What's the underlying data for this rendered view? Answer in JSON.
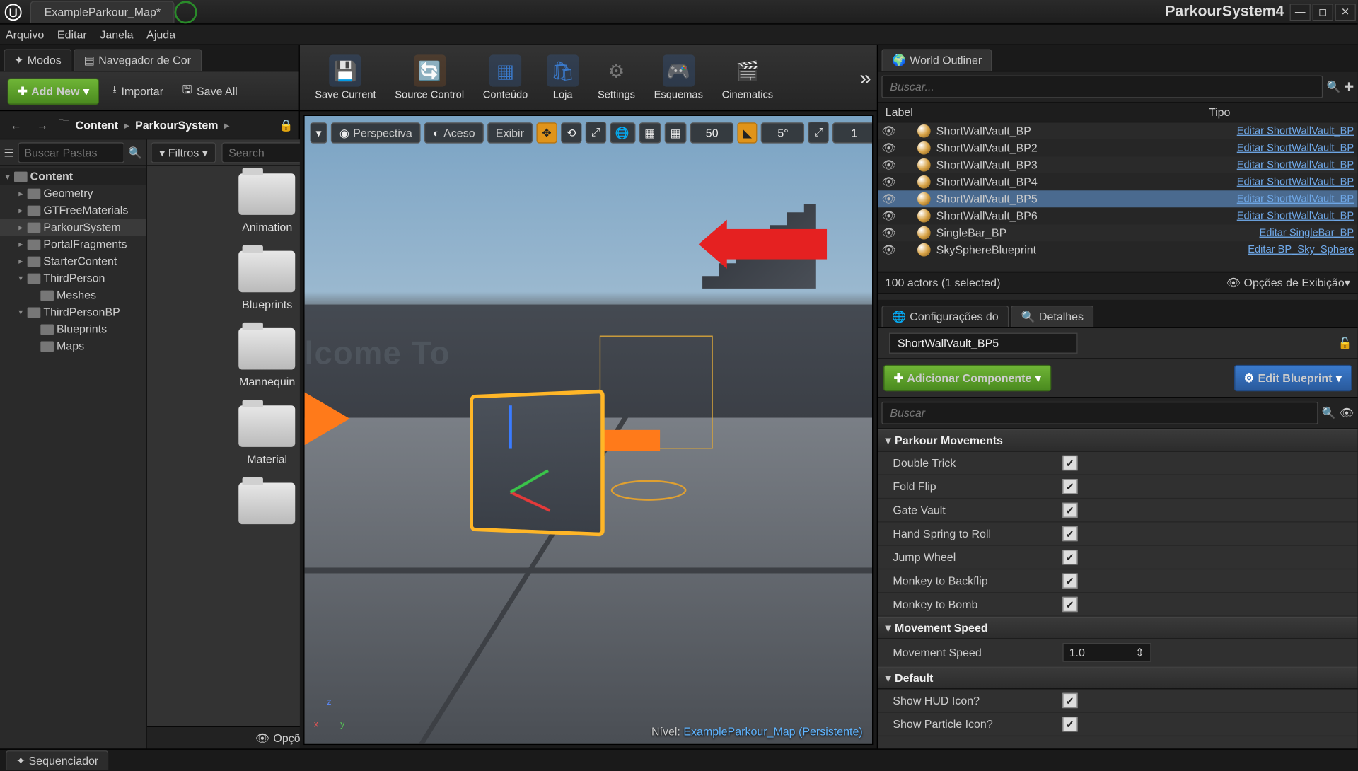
{
  "titlebar": {
    "map": "ExampleParkour_Map*",
    "app": "ParkourSystem4"
  },
  "menu": [
    "Arquivo",
    "Editar",
    "Janela",
    "Ajuda"
  ],
  "left_tabs": {
    "modes": "Modos",
    "cb": "Navegador de Cor"
  },
  "cb_toolbar": {
    "add": "Add New",
    "import": "Importar",
    "saveall": "Save All"
  },
  "breadcrumb": [
    "Content",
    "ParkourSystem"
  ],
  "tree_search_ph": "Buscar Pastas",
  "tree": [
    {
      "l": "Content",
      "d": 0,
      "tw": "▾",
      "root": true
    },
    {
      "l": "Geometry",
      "d": 1,
      "tw": "▸"
    },
    {
      "l": "GTFreeMaterials",
      "d": 1,
      "tw": "▸"
    },
    {
      "l": "ParkourSystem",
      "d": 1,
      "tw": "▸",
      "sel": true
    },
    {
      "l": "PortalFragments",
      "d": 1,
      "tw": "▸"
    },
    {
      "l": "StarterContent",
      "d": 1,
      "tw": "▸"
    },
    {
      "l": "ThirdPerson",
      "d": 1,
      "tw": "▾"
    },
    {
      "l": "Meshes",
      "d": 2,
      "tw": ""
    },
    {
      "l": "ThirdPersonBP",
      "d": 1,
      "tw": "▾"
    },
    {
      "l": "Blueprints",
      "d": 2,
      "tw": ""
    },
    {
      "l": "Maps",
      "d": 2,
      "tw": ""
    }
  ],
  "filters": "Filtros",
  "asset_search_ph": "Search",
  "assets": [
    "Animation",
    "Blueprints",
    "Mannequin",
    "Material",
    ""
  ],
  "view_options": "Opções de Exibição",
  "main_toolbar": [
    {
      "l": "Save Current",
      "c": "#3a7acc",
      "g": "💾"
    },
    {
      "l": "Source Control",
      "c": "#b96a2a",
      "g": "🔄"
    },
    {
      "l": "Conteúdo",
      "c": "#3a7acc",
      "g": "▦"
    },
    {
      "l": "Loja",
      "c": "#3a7acc",
      "g": "🛍"
    },
    {
      "l": "Settings",
      "c": "#777",
      "g": "⚙"
    },
    {
      "l": "Esquemas",
      "c": "#3a7acc",
      "g": "🎮"
    },
    {
      "l": "Cinematics",
      "c": "#777",
      "g": "🎬"
    }
  ],
  "vp": {
    "persp": "Perspectiva",
    "lit": "Aceso",
    "show": "Exibir",
    "snap1": "50",
    "snap2": "5°",
    "snap3": "1"
  },
  "vp_footer": {
    "pre": "Nível:",
    "level": "ExampleParkour_Map (Persistente)"
  },
  "welcome": "lcome To",
  "outliner": {
    "tab": "World Outliner",
    "search_ph": "Buscar...",
    "h1": "Label",
    "h2": "Tipo",
    "rows": [
      {
        "n": "ShortWallVault_BP",
        "t": "Editar ShortWallVault_BP"
      },
      {
        "n": "ShortWallVault_BP2",
        "t": "Editar ShortWallVault_BP"
      },
      {
        "n": "ShortWallVault_BP3",
        "t": "Editar ShortWallVault_BP"
      },
      {
        "n": "ShortWallVault_BP4",
        "t": "Editar ShortWallVault_BP"
      },
      {
        "n": "ShortWallVault_BP5",
        "t": "Editar ShortWallVault_BP",
        "sel": true
      },
      {
        "n": "ShortWallVault_BP6",
        "t": "Editar ShortWallVault_BP"
      },
      {
        "n": "SingleBar_BP",
        "t": "Editar SingleBar_BP"
      },
      {
        "n": "SkySphereBlueprint",
        "t": "Editar BP_Sky_Sphere"
      }
    ],
    "footer_l": "100 actors (1 selected)",
    "footer_r": "Opções de Exibição"
  },
  "details": {
    "tab1": "Configurações do",
    "tab2": "Detalhes",
    "actor": "ShortWallVault_BP5",
    "add": "Adicionar Componente",
    "edit": "Edit Blueprint",
    "search_ph": "Buscar",
    "sects": [
      {
        "h": "Parkour Movements",
        "rows": [
          {
            "l": "Double Trick",
            "chk": true
          },
          {
            "l": "Fold Flip",
            "chk": true
          },
          {
            "l": "Gate Vault",
            "chk": true
          },
          {
            "l": "Hand Spring to Roll",
            "chk": true
          },
          {
            "l": "Jump Wheel",
            "chk": true
          },
          {
            "l": "Monkey to Backflip",
            "chk": true
          },
          {
            "l": "Monkey to Bomb",
            "chk": true
          }
        ]
      },
      {
        "h": "Movement Speed",
        "rows": [
          {
            "l": "Movement Speed",
            "val": "1.0"
          }
        ]
      },
      {
        "h": "Default",
        "rows": [
          {
            "l": "Show HUD Icon?",
            "chk": true
          },
          {
            "l": "Show Particle Icon?",
            "chk": true
          }
        ]
      }
    ]
  },
  "bottom": {
    "seq": "Sequenciador"
  }
}
